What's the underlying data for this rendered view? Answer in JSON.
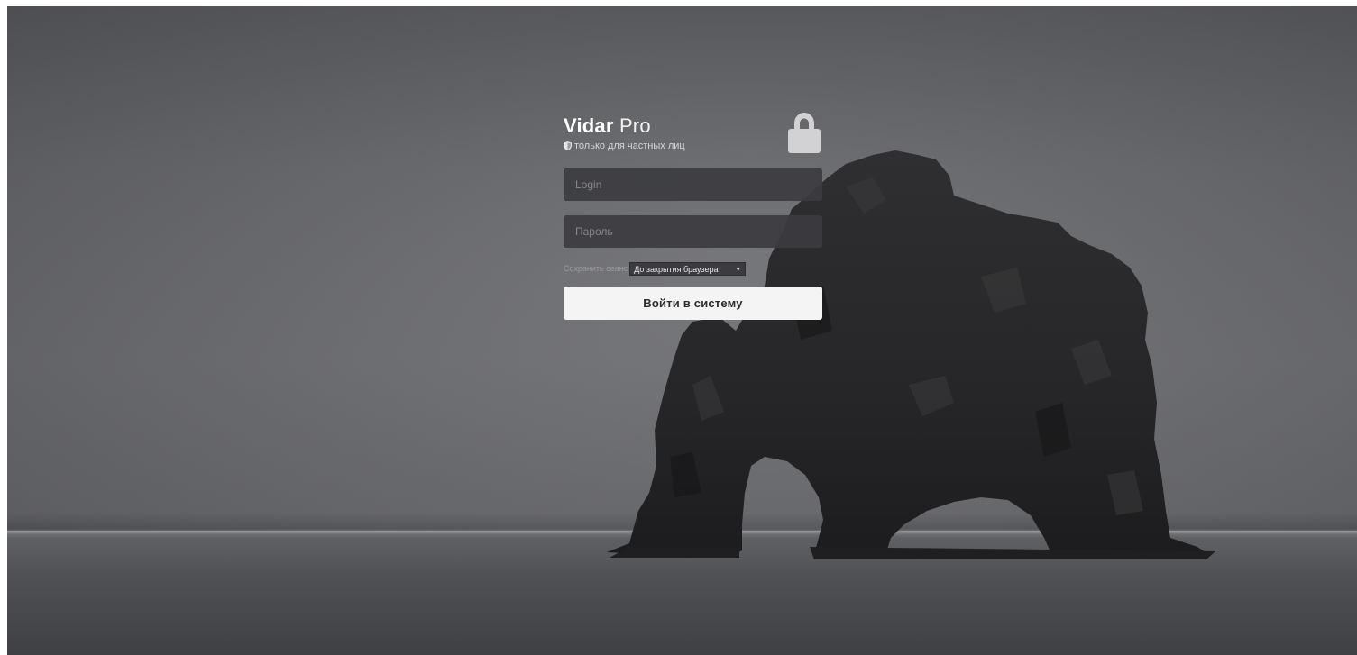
{
  "app": {
    "brand_bold": "Vidar",
    "brand_light": "Pro",
    "subtitle": "только для частных лиц"
  },
  "form": {
    "login_placeholder": "Login",
    "password_placeholder": "Пароль",
    "session_label": "Сохранить сеанс",
    "session_value": "До закрытия браузера",
    "submit_label": "Войти в систему"
  },
  "icons": {
    "shield": "shield-icon",
    "lock": "lock-icon",
    "dropdown": "triangle-down-icon"
  },
  "colors": {
    "button_bg": "#f4f4f4",
    "input_bg": "#3c3c40",
    "text_primary": "#ffffff"
  }
}
